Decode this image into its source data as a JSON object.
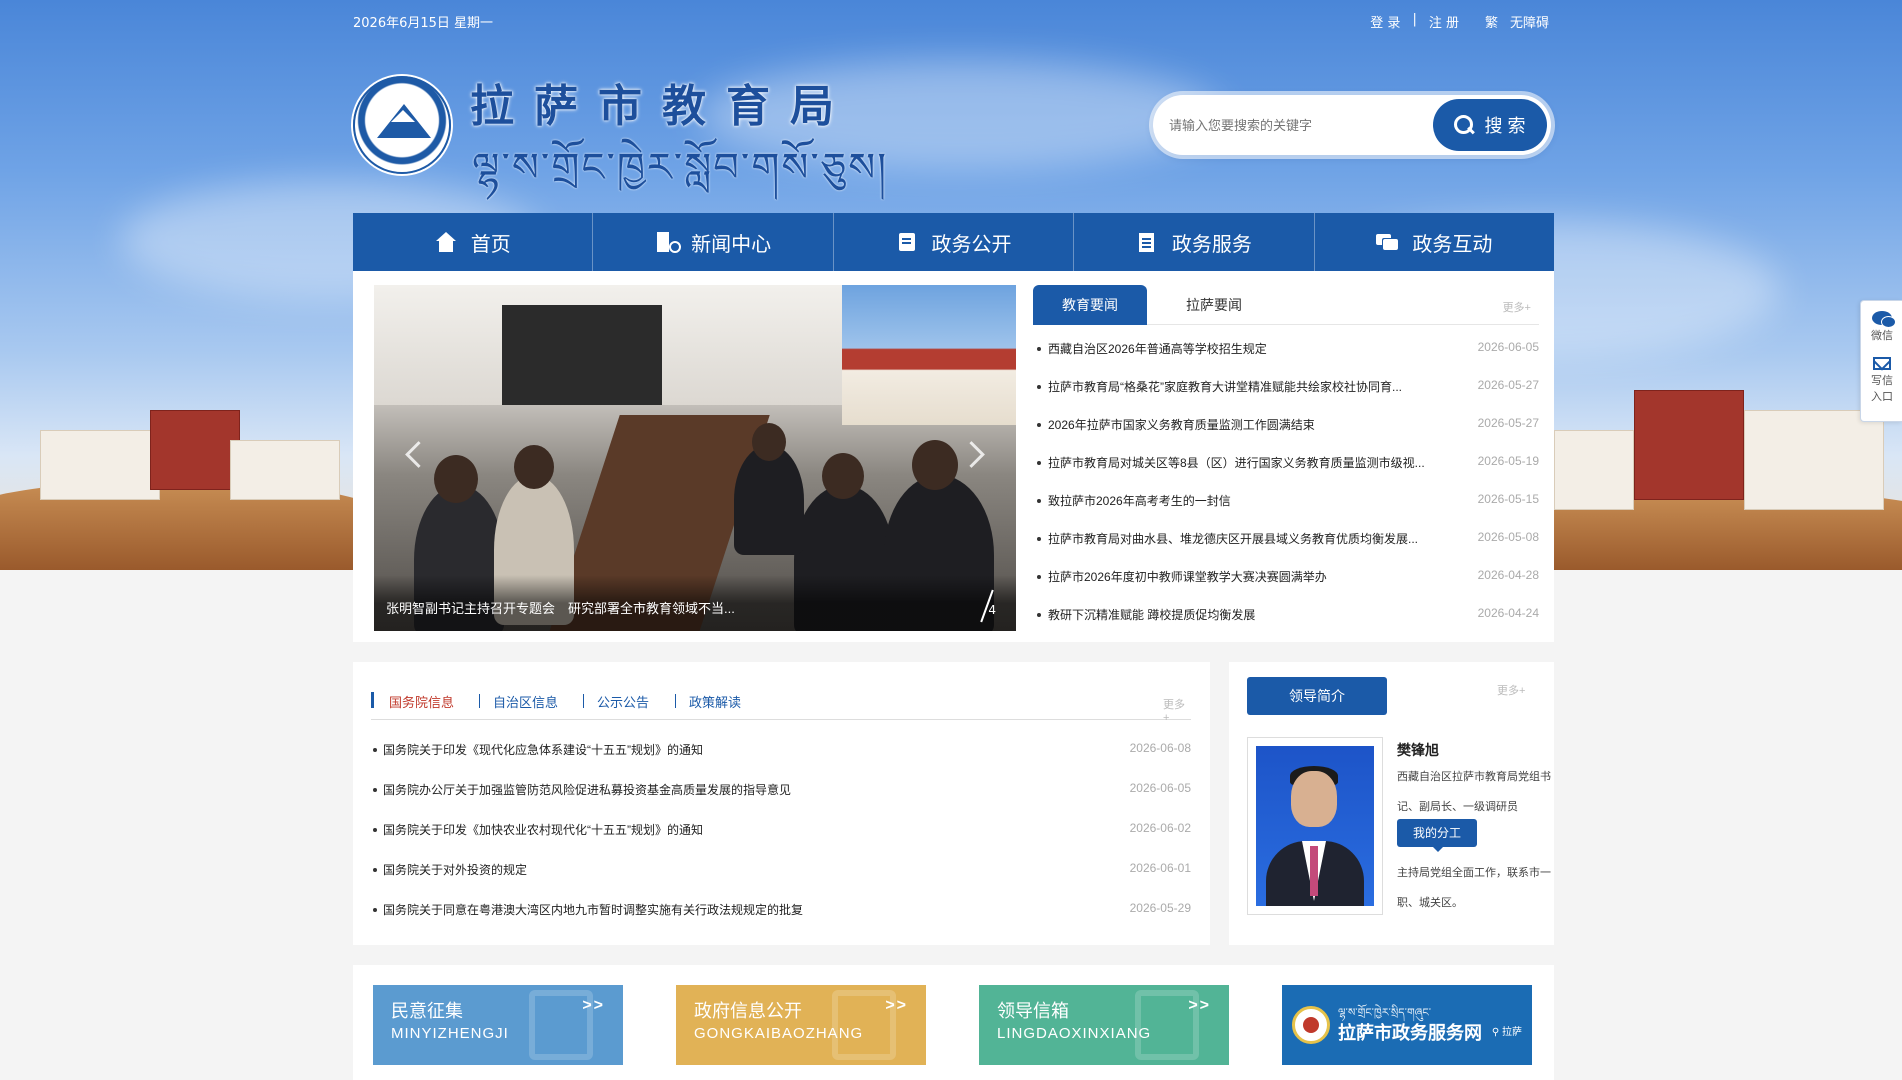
{
  "topbar": {
    "date": "2026年6月15日  星期一",
    "login": "登 录",
    "divider": "|",
    "register": "注 册",
    "traditional": "繁",
    "accessible": "无障碍"
  },
  "header": {
    "title_cn": "拉萨市教育局",
    "title_bo": "ལྷ་ས་གྲོང་ཁྱེར་སློབ་གསོ་ཅུས།"
  },
  "search": {
    "placeholder": "请输入您要搜索的关键字",
    "button_label": "搜 索"
  },
  "nav": {
    "items": [
      {
        "label": "首页",
        "icon": "home-icon"
      },
      {
        "label": "新闻中心",
        "icon": "building-icon"
      },
      {
        "label": "政务公开",
        "icon": "book-icon"
      },
      {
        "label": "政务服务",
        "icon": "document-icon"
      },
      {
        "label": "政务互动",
        "icon": "chat-icon"
      }
    ]
  },
  "slider": {
    "caption": "张明智副书记主持召开专题会　研究部署全市教育领域不当...",
    "page": "4"
  },
  "news1": {
    "tabs": [
      "教育要闻",
      "拉萨要闻"
    ],
    "active_tab": 0,
    "more": "更多+",
    "items": [
      {
        "title": "西藏自治区2026年普通高等学校招生规定",
        "date": "2026-06-05"
      },
      {
        "title": "拉萨市教育局“格桑花”家庭教育大讲堂精准赋能共绘家校社协同育...",
        "date": "2026-05-27"
      },
      {
        "title": "2026年拉萨市国家义务教育质量监测工作圆满结束",
        "date": "2026-05-27"
      },
      {
        "title": "拉萨市教育局对城关区等8县（区）进行国家义务教育质量监测市级视...",
        "date": "2026-05-19"
      },
      {
        "title": "致拉萨市2026年高考考生的一封信",
        "date": "2026-05-15"
      },
      {
        "title": "拉萨市教育局对曲水县、堆龙德庆区开展县域义务教育优质均衡发展...",
        "date": "2026-05-08"
      },
      {
        "title": "拉萨市2026年度初中教师课堂教学大赛决赛圆满举办",
        "date": "2026-04-28"
      },
      {
        "title": "教研下沉精准赋能 蹲校提质促均衡发展",
        "date": "2026-04-24"
      }
    ]
  },
  "side_widget": {
    "wechat": "微信",
    "letter_line1": "写信",
    "letter_line2": "入口"
  },
  "news2": {
    "tabs": [
      "国务院信息",
      "自治区信息",
      "公示公告",
      "政策解读"
    ],
    "active_tab": 0,
    "more": "更多+",
    "items": [
      {
        "title": "国务院关于印发《现代化应急体系建设“十五五”规划》的通知",
        "date": "2026-06-08"
      },
      {
        "title": "国务院办公厅关于加强监管防范风险促进私募投资基金高质量发展的指导意见",
        "date": "2026-06-05"
      },
      {
        "title": "国务院关于印发《加快农业农村现代化“十五五”规划》的通知",
        "date": "2026-06-02"
      },
      {
        "title": "国务院关于对外投资的规定",
        "date": "2026-06-01"
      },
      {
        "title": "国务院关于同意在粤港澳大湾区内地九市暂时调整实施有关行政法规规定的批复",
        "date": "2026-05-29"
      }
    ]
  },
  "leader": {
    "button_label": "领导简介",
    "more": "更多+",
    "name": "樊锋旭",
    "title": "西藏自治区拉萨市教育局党组书记、副局长、一级调研员",
    "duty_button": "我的分工",
    "duty": "主持局党组全面工作，联系市一职、城关区。"
  },
  "tiles": [
    {
      "title": "民意征集",
      "subtitle": "MINYIZHENGJI",
      "arrow": ">>",
      "color": "#5b9bd0"
    },
    {
      "title": "政府信息公开",
      "subtitle": "GONGKAIBAOZHANG",
      "arrow": ">>",
      "color": "#e1b256"
    },
    {
      "title": "领导信箱",
      "subtitle": "LINGDAOXINXIANG",
      "arrow": ">>",
      "color": "#52b496"
    },
    {
      "title": "拉萨市政务服务网",
      "bo": "ལྷ་ས་གྲོང་ཁྱེར་སྲིད་གཞུང་",
      "pin": "拉萨",
      "color": "#1b6cb4"
    }
  ]
}
